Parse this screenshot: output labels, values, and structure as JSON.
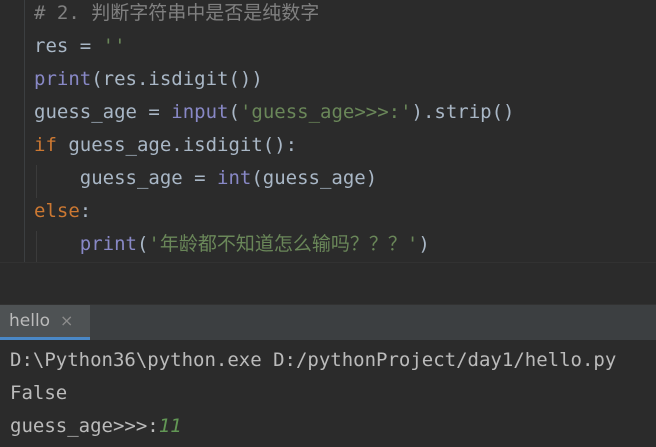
{
  "editor": {
    "lines": [
      [
        {
          "t": "# 2. 判断字符串中是否是纯数字",
          "c": "comment"
        }
      ],
      [
        {
          "t": "res = ",
          "c": "default"
        },
        {
          "t": "''",
          "c": "string"
        }
      ],
      [
        {
          "t": "print",
          "c": "builtin"
        },
        {
          "t": "(res.isdigit())",
          "c": "default"
        }
      ],
      [
        {
          "t": "guess_age = ",
          "c": "default"
        },
        {
          "t": "input",
          "c": "builtin"
        },
        {
          "t": "(",
          "c": "default"
        },
        {
          "t": "'guess_age>>>:'",
          "c": "string"
        },
        {
          "t": ").strip()",
          "c": "default"
        }
      ],
      [
        {
          "t": "if ",
          "c": "keyword"
        },
        {
          "t": "guess_age.isdigit():",
          "c": "default"
        }
      ],
      [
        {
          "t": "    guess_age = ",
          "c": "default"
        },
        {
          "t": "int",
          "c": "builtin"
        },
        {
          "t": "(guess_age)",
          "c": "default"
        }
      ],
      [
        {
          "t": "else",
          "c": "keyword"
        },
        {
          "t": ":",
          "c": "default"
        }
      ],
      [
        {
          "t": "    ",
          "c": "default"
        },
        {
          "t": "print",
          "c": "builtin"
        },
        {
          "t": "(",
          "c": "default"
        },
        {
          "t": "'年龄都不知道怎么输吗？？？'",
          "c": "string"
        },
        {
          "t": ")",
          "c": "default"
        }
      ]
    ]
  },
  "run_panel": {
    "tab_label": "hello",
    "close_glyph": "×",
    "console": {
      "command": "D:\\Python36\\python.exe D:/pythonProject/day1/hello.py",
      "output": "False",
      "prompt": "guess_age>>>:",
      "user_input": "11"
    }
  },
  "colors": {
    "background": "#2b2b2b",
    "comment": "#808080",
    "keyword": "#cc7832",
    "builtin": "#8888c6",
    "string": "#6a8759",
    "default": "#a9b7c6",
    "tab_active_underline": "#4a88c7",
    "console_input": "#629755"
  }
}
